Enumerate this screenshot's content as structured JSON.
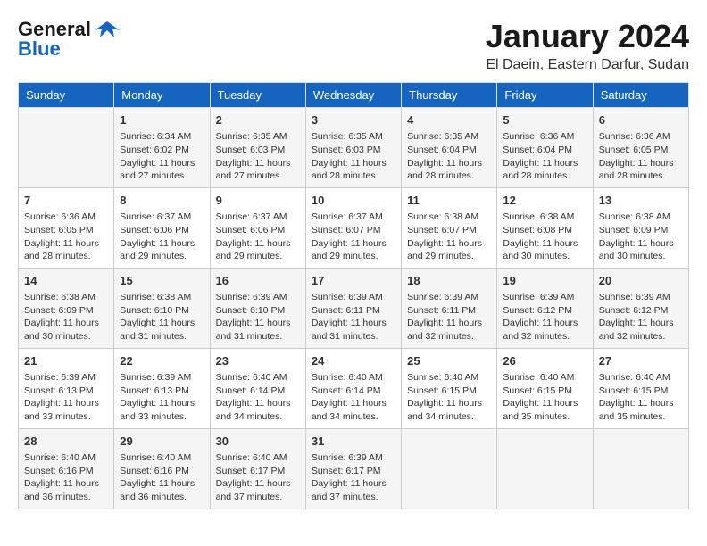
{
  "header": {
    "logo_line1": "General",
    "logo_line2": "Blue",
    "month_title": "January 2024",
    "location": "El Daein, Eastern Darfur, Sudan"
  },
  "days_of_week": [
    "Sunday",
    "Monday",
    "Tuesday",
    "Wednesday",
    "Thursday",
    "Friday",
    "Saturday"
  ],
  "weeks": [
    [
      {
        "day": "",
        "detail": ""
      },
      {
        "day": "1",
        "detail": "Sunrise: 6:34 AM\nSunset: 6:02 PM\nDaylight: 11 hours and 27 minutes."
      },
      {
        "day": "2",
        "detail": "Sunrise: 6:35 AM\nSunset: 6:03 PM\nDaylight: 11 hours and 27 minutes."
      },
      {
        "day": "3",
        "detail": "Sunrise: 6:35 AM\nSunset: 6:03 PM\nDaylight: 11 hours and 28 minutes."
      },
      {
        "day": "4",
        "detail": "Sunrise: 6:35 AM\nSunset: 6:04 PM\nDaylight: 11 hours and 28 minutes."
      },
      {
        "day": "5",
        "detail": "Sunrise: 6:36 AM\nSunset: 6:04 PM\nDaylight: 11 hours and 28 minutes."
      },
      {
        "day": "6",
        "detail": "Sunrise: 6:36 AM\nSunset: 6:05 PM\nDaylight: 11 hours and 28 minutes."
      }
    ],
    [
      {
        "day": "7",
        "detail": "Sunrise: 6:36 AM\nSunset: 6:05 PM\nDaylight: 11 hours and 28 minutes."
      },
      {
        "day": "8",
        "detail": "Sunrise: 6:37 AM\nSunset: 6:06 PM\nDaylight: 11 hours and 29 minutes."
      },
      {
        "day": "9",
        "detail": "Sunrise: 6:37 AM\nSunset: 6:06 PM\nDaylight: 11 hours and 29 minutes."
      },
      {
        "day": "10",
        "detail": "Sunrise: 6:37 AM\nSunset: 6:07 PM\nDaylight: 11 hours and 29 minutes."
      },
      {
        "day": "11",
        "detail": "Sunrise: 6:38 AM\nSunset: 6:07 PM\nDaylight: 11 hours and 29 minutes."
      },
      {
        "day": "12",
        "detail": "Sunrise: 6:38 AM\nSunset: 6:08 PM\nDaylight: 11 hours and 30 minutes."
      },
      {
        "day": "13",
        "detail": "Sunrise: 6:38 AM\nSunset: 6:09 PM\nDaylight: 11 hours and 30 minutes."
      }
    ],
    [
      {
        "day": "14",
        "detail": "Sunrise: 6:38 AM\nSunset: 6:09 PM\nDaylight: 11 hours and 30 minutes."
      },
      {
        "day": "15",
        "detail": "Sunrise: 6:38 AM\nSunset: 6:10 PM\nDaylight: 11 hours and 31 minutes."
      },
      {
        "day": "16",
        "detail": "Sunrise: 6:39 AM\nSunset: 6:10 PM\nDaylight: 11 hours and 31 minutes."
      },
      {
        "day": "17",
        "detail": "Sunrise: 6:39 AM\nSunset: 6:11 PM\nDaylight: 11 hours and 31 minutes."
      },
      {
        "day": "18",
        "detail": "Sunrise: 6:39 AM\nSunset: 6:11 PM\nDaylight: 11 hours and 32 minutes."
      },
      {
        "day": "19",
        "detail": "Sunrise: 6:39 AM\nSunset: 6:12 PM\nDaylight: 11 hours and 32 minutes."
      },
      {
        "day": "20",
        "detail": "Sunrise: 6:39 AM\nSunset: 6:12 PM\nDaylight: 11 hours and 32 minutes."
      }
    ],
    [
      {
        "day": "21",
        "detail": "Sunrise: 6:39 AM\nSunset: 6:13 PM\nDaylight: 11 hours and 33 minutes."
      },
      {
        "day": "22",
        "detail": "Sunrise: 6:39 AM\nSunset: 6:13 PM\nDaylight: 11 hours and 33 minutes."
      },
      {
        "day": "23",
        "detail": "Sunrise: 6:40 AM\nSunset: 6:14 PM\nDaylight: 11 hours and 34 minutes."
      },
      {
        "day": "24",
        "detail": "Sunrise: 6:40 AM\nSunset: 6:14 PM\nDaylight: 11 hours and 34 minutes."
      },
      {
        "day": "25",
        "detail": "Sunrise: 6:40 AM\nSunset: 6:15 PM\nDaylight: 11 hours and 34 minutes."
      },
      {
        "day": "26",
        "detail": "Sunrise: 6:40 AM\nSunset: 6:15 PM\nDaylight: 11 hours and 35 minutes."
      },
      {
        "day": "27",
        "detail": "Sunrise: 6:40 AM\nSunset: 6:15 PM\nDaylight: 11 hours and 35 minutes."
      }
    ],
    [
      {
        "day": "28",
        "detail": "Sunrise: 6:40 AM\nSunset: 6:16 PM\nDaylight: 11 hours and 36 minutes."
      },
      {
        "day": "29",
        "detail": "Sunrise: 6:40 AM\nSunset: 6:16 PM\nDaylight: 11 hours and 36 minutes."
      },
      {
        "day": "30",
        "detail": "Sunrise: 6:40 AM\nSunset: 6:17 PM\nDaylight: 11 hours and 37 minutes."
      },
      {
        "day": "31",
        "detail": "Sunrise: 6:39 AM\nSunset: 6:17 PM\nDaylight: 11 hours and 37 minutes."
      },
      {
        "day": "",
        "detail": ""
      },
      {
        "day": "",
        "detail": ""
      },
      {
        "day": "",
        "detail": ""
      }
    ]
  ]
}
